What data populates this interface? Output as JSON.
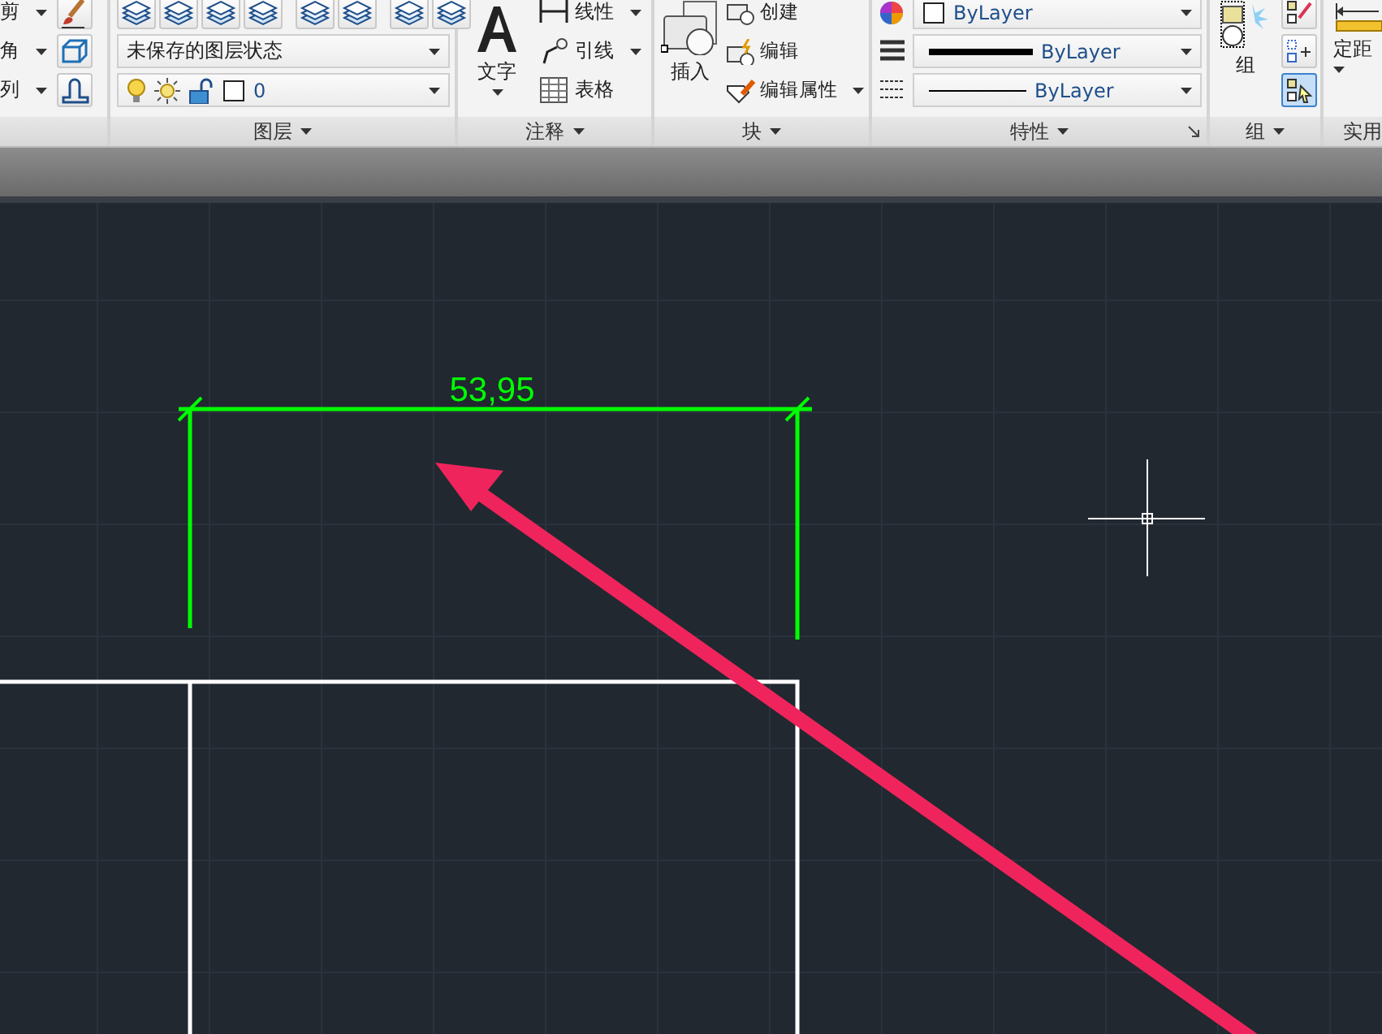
{
  "modify_panel": {
    "tools": [
      {
        "label": "剪"
      },
      {
        "label": "角"
      },
      {
        "label": "列"
      }
    ]
  },
  "layers_panel": {
    "title": "图层",
    "layer_state": {
      "value": "未保存的图层状态"
    },
    "layer": {
      "value": "0"
    }
  },
  "annotation_panel": {
    "title": "注释",
    "text_tool": "文字",
    "tools": [
      {
        "label": "线性",
        "dropdown": true
      },
      {
        "label": "引线",
        "dropdown": true
      },
      {
        "label": "表格",
        "dropdown": false
      }
    ]
  },
  "block_panel": {
    "title": "块",
    "insert": "插入",
    "tools": [
      {
        "label": "创建",
        "dropdown": false
      },
      {
        "label": "编辑",
        "dropdown": false
      },
      {
        "label": "编辑属性",
        "dropdown": true
      }
    ]
  },
  "properties_panel": {
    "title": "特性",
    "rows": [
      {
        "kind": "color",
        "value": "ByLayer"
      },
      {
        "kind": "lineweight",
        "value": "ByLayer"
      },
      {
        "kind": "linetype",
        "value": "ByLayer"
      }
    ]
  },
  "groups_panel": {
    "title": "组",
    "group_tool": "组",
    "tools": [
      {
        "selected": false
      },
      {
        "selected": false
      },
      {
        "selected": true
      }
    ]
  },
  "utilities_panel": {
    "title": "实用",
    "measure_tool": "定距"
  },
  "canvas": {
    "dimension": {
      "text": "53,95"
    }
  }
}
